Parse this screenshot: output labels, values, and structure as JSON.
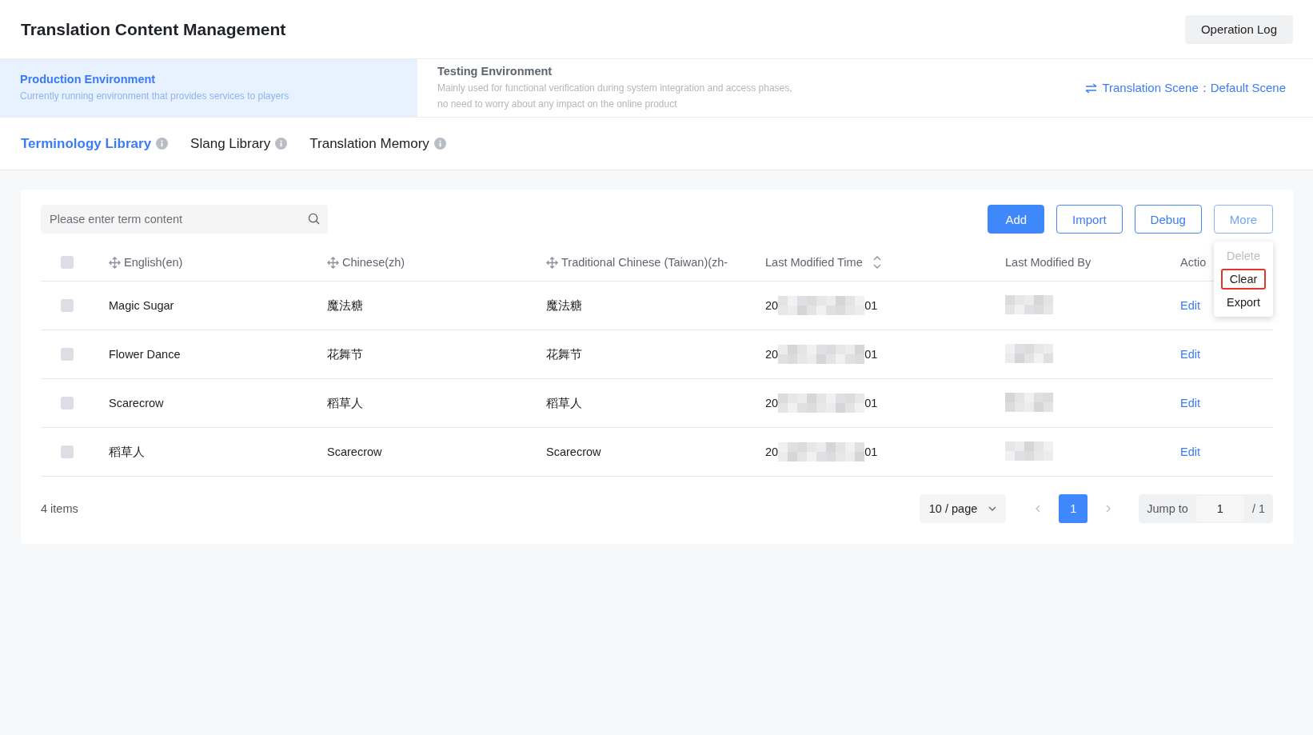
{
  "header": {
    "title": "Translation Content Management",
    "operation_log_button": "Operation Log"
  },
  "environments": [
    {
      "title": "Production Environment",
      "description": "Currently running environment that provides services to players",
      "selected": true
    },
    {
      "title": "Testing Environment",
      "description": "Mainly used for functional verification during system integration and access phases, no need to worry about any impact on the online product",
      "selected": false
    }
  ],
  "scene": {
    "label": "Translation Scene：",
    "value": "Default Scene"
  },
  "library_tabs": [
    {
      "label": "Terminology Library",
      "selected": true
    },
    {
      "label": "Slang Library",
      "selected": false
    },
    {
      "label": "Translation Memory",
      "selected": false
    }
  ],
  "search": {
    "placeholder": "Please enter term content"
  },
  "buttons": [
    {
      "label": "Add",
      "kind": "primary"
    },
    {
      "label": "Import",
      "kind": "outline"
    },
    {
      "label": "Debug",
      "kind": "outline"
    },
    {
      "label": "More",
      "kind": "open"
    }
  ],
  "more_menu": [
    {
      "label": "Delete",
      "disabled": true,
      "highlighted": false
    },
    {
      "label": "Clear",
      "disabled": false,
      "highlighted": true
    },
    {
      "label": "Export",
      "disabled": false,
      "highlighted": false
    }
  ],
  "table": {
    "select_all_checked": false,
    "columns": [
      {
        "label": "English(en)",
        "draggable": true,
        "sortable": false
      },
      {
        "label": "Chinese(zh)",
        "draggable": true,
        "sortable": false
      },
      {
        "label": "Traditional Chinese (Taiwan)(zh-",
        "draggable": true,
        "sortable": false
      },
      {
        "label": "Last Modified Time",
        "draggable": false,
        "sortable": true
      },
      {
        "label": "Last Modified By",
        "draggable": false,
        "sortable": false
      },
      {
        "label": "Actio",
        "draggable": false,
        "sortable": false
      }
    ],
    "rows": [
      {
        "checked": false,
        "english": "Magic Sugar",
        "chinese": "魔法糖",
        "traditional": "魔法糖",
        "time_start": "20",
        "time_end": "01",
        "modified_by_blurred": true,
        "action": "Edit"
      },
      {
        "checked": false,
        "english": "Flower Dance",
        "chinese": "花舞节",
        "traditional": "花舞节",
        "time_start": "20",
        "time_end": "01",
        "modified_by_blurred": true,
        "action": "Edit"
      },
      {
        "checked": false,
        "english": "Scarecrow",
        "chinese": "稻草人",
        "traditional": "稻草人",
        "time_start": "20",
        "time_end": "01",
        "modified_by_blurred": true,
        "action": "Edit"
      },
      {
        "checked": false,
        "english": "稻草人",
        "chinese": "Scarecrow",
        "traditional": "Scarecrow",
        "time_start": "20",
        "time_end": "01",
        "modified_by_blurred": true,
        "action": "Edit"
      }
    ]
  },
  "pagination": {
    "total": "4 items",
    "page_size": "10 / page",
    "pages": [
      {
        "label": "1",
        "selected": true
      }
    ],
    "jump_label": "Jump to",
    "jump_value": "1",
    "page_count": "/ 1"
  }
}
